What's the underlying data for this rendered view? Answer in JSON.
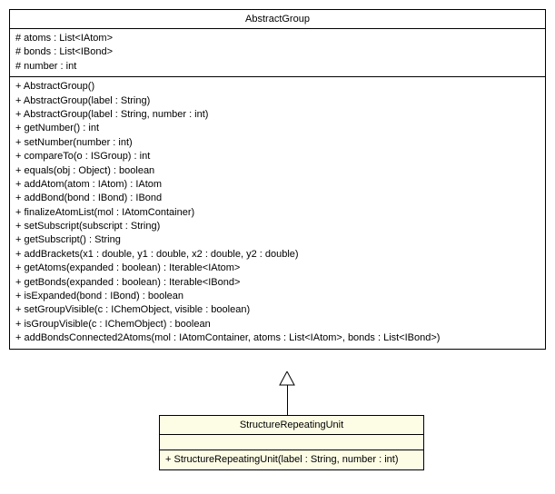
{
  "parent": {
    "name": "AbstractGroup",
    "fields": [
      "# atoms : List<IAtom>",
      "# bonds : List<IBond>",
      "# number : int"
    ],
    "methods": [
      "+ AbstractGroup()",
      "+ AbstractGroup(label : String)",
      "+ AbstractGroup(label : String, number : int)",
      "+ getNumber() : int",
      "+ setNumber(number : int)",
      "+ compareTo(o : ISGroup) : int",
      "+ equals(obj : Object) : boolean",
      "+ addAtom(atom : IAtom) : IAtom",
      "+ addBond(bond : IBond) : IBond",
      "+ finalizeAtomList(mol : IAtomContainer)",
      "+ setSubscript(subscript : String)",
      "+ getSubscript() : String",
      "+ addBrackets(x1 : double, y1 : double, x2 : double, y2 : double)",
      "+ getAtoms(expanded : boolean) : Iterable<IAtom>",
      "+ getBonds(expanded : boolean) : Iterable<IBond>",
      "+ isExpanded(bond : IBond) : boolean",
      "+ setGroupVisible(c : IChemObject, visible : boolean)",
      "+ isGroupVisible(c : IChemObject) : boolean",
      "+ addBondsConnected2Atoms(mol : IAtomContainer, atoms : List<IAtom>, bonds : List<IBond>)"
    ]
  },
  "child": {
    "name": "StructureRepeatingUnit",
    "fields": [],
    "methods": [
      "+ StructureRepeatingUnit(label : String, number : int)"
    ]
  }
}
